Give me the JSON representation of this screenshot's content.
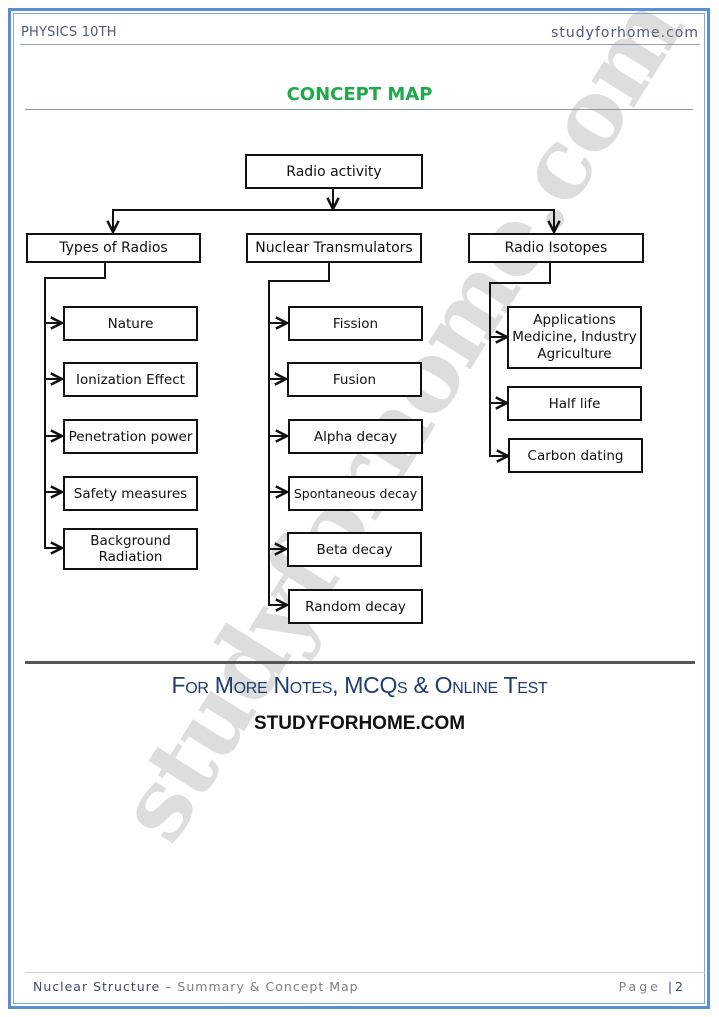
{
  "header": {
    "left": "PHYSICS 10TH",
    "right": "studyforhome.com"
  },
  "title": "CONCEPT MAP",
  "concept_map": {
    "root": "Radio activity",
    "branches": [
      {
        "label": "Types of Radios",
        "children": [
          "Nature",
          "Ionization Effect",
          "Penetration power",
          "Safety measures",
          "Background\nRadiation"
        ]
      },
      {
        "label": "Nuclear Transmulators",
        "children": [
          "Fission",
          "Fusion",
          "Alpha decay",
          "Spontaneous decay",
          "Beta decay",
          "Random decay"
        ]
      },
      {
        "label": "Radio Isotopes",
        "children": [
          "Applications\nMedicine, Industry\nAgriculture",
          "Half life",
          "Carbon dating"
        ]
      }
    ]
  },
  "watermark": "studyforhome.com",
  "promo": {
    "line": "For More Notes, MCQs & Online Test",
    "site": "STUDYFORHOME.COM"
  },
  "footer": {
    "chapter": "Nuclear Structure",
    "subtitle": " – Summary & Concept Map",
    "page_label": "Page ",
    "page_sep": "|",
    "page_number": "2"
  },
  "colors": {
    "title": "#1faa4a",
    "frame": "#5b8fd4",
    "promo": "#1f3c6e"
  }
}
